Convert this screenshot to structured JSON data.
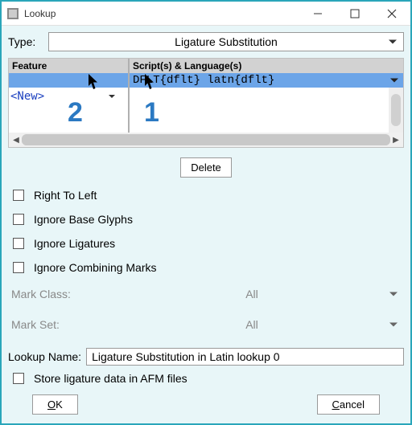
{
  "title": "Lookup",
  "type": {
    "label": "Type:",
    "value": "Ligature Substitution"
  },
  "table": {
    "headers": {
      "feature": "Feature",
      "script": "Script(s) & Language(s)"
    },
    "script_value": "DFLT{dflt} latn{dflt}",
    "new_label": "<New>"
  },
  "delete_btn": "Delete",
  "checks": {
    "rtl": "Right To Left",
    "ignore_base": "Ignore Base Glyphs",
    "ignore_liga": "Ignore Ligatures",
    "ignore_comb": "Ignore Combining Marks",
    "store_afm": "Store ligature data in AFM files"
  },
  "mark_class": {
    "label": "Mark Class:",
    "value": "All"
  },
  "mark_set": {
    "label": "Mark Set:",
    "value": "All"
  },
  "lookup_name": {
    "label": "Lookup Name:",
    "value": "Ligature Substitution in Latin lookup 0"
  },
  "buttons": {
    "ok": "OK",
    "cancel": "Cancel"
  },
  "annotations": {
    "one": "1",
    "two": "2"
  }
}
